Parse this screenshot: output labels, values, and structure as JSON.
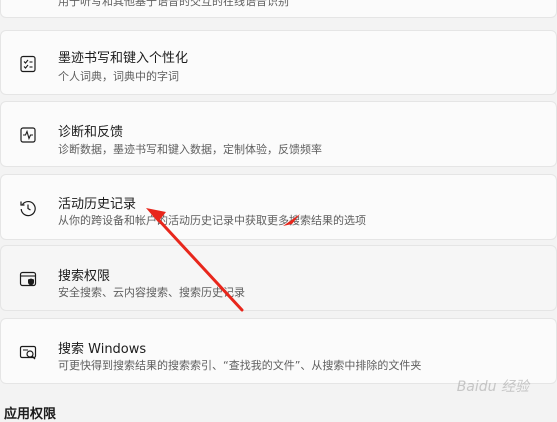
{
  "cards": [
    {
      "title": "",
      "desc": "用于听写和其他基于语音的交互的在线语音识别",
      "icon": "microphone-icon"
    },
    {
      "title": "墨迹书写和键入个性化",
      "desc": "个人词典，词典中的字词",
      "icon": "personal-dictionary-icon"
    },
    {
      "title": "诊断和反馈",
      "desc": "诊断数据，墨迹书写和键入数据，定制体验，反馈频率",
      "icon": "diagnostics-icon"
    },
    {
      "title": "活动历史记录",
      "desc": "从你的跨设备和帐户的活动历史记录中获取更多搜索结果的选项",
      "icon": "activity-history-icon"
    },
    {
      "title": "搜索权限",
      "desc": "安全搜索、云内容搜索、搜索历史记录",
      "icon": "search-permissions-icon"
    },
    {
      "title": "搜索 Windows",
      "desc": "可更快得到搜索结果的搜索索引、“查找我的文件”、从搜索中排除的文件夹",
      "icon": "search-windows-icon"
    }
  ],
  "section": {
    "title": "应用权限"
  },
  "watermark": "Baidu 经验",
  "colors": {
    "arrow": "#e8271c",
    "card_bg": "#fbfbfb",
    "page_bg": "#f3f3f3"
  }
}
